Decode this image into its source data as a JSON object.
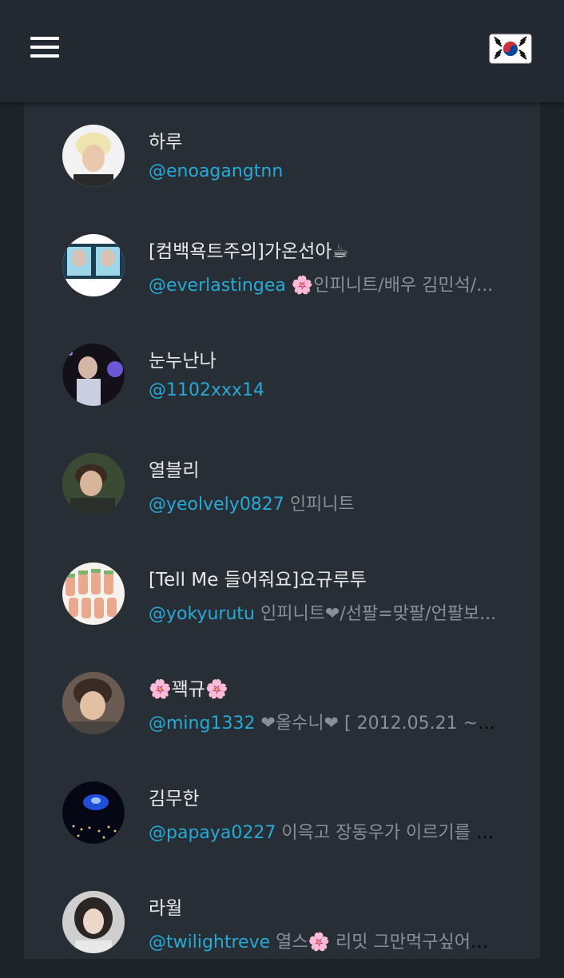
{
  "header": {
    "menu_icon": "hamburger-menu-icon",
    "language_flag": "south-korea-flag-icon"
  },
  "colors": {
    "background": "#1e232a",
    "topbar": "#232930",
    "panel": "#282e36",
    "handle": "#27a9d6",
    "name": "#e8e8e8",
    "bio": "#8a8f96"
  },
  "users": [
    {
      "name": "하루",
      "handle": "@enoagangtnn",
      "bio": ""
    },
    {
      "name": "[컴백욕트주의]가온선아☕",
      "handle": "@everlastingea",
      "bio": "🌸인피니트/배우 김민석/..."
    },
    {
      "name": "눈누난나",
      "handle": "@1102xxx14",
      "bio": ""
    },
    {
      "name": "열블리",
      "handle": "@yeolvely0827",
      "bio": "인피니트"
    },
    {
      "name": "[Tell Me 들어줘요]요규루투",
      "handle": "@yokyurutu",
      "bio": "인피니트❤/선팔=맞팔/언팔보..."
    },
    {
      "name": "🌸꽥규🌸",
      "handle": "@ming1332",
      "bio": "❤올수니❤ [ 2012.05.21 ~ i..."
    },
    {
      "name": "김무한",
      "handle": "@papaya0227",
      "bio": "이윽고 장동우가 이르기를 [..."
    },
    {
      "name": "라월",
      "handle": "@twilightreve",
      "bio": "열스🌸 리밋 그만먹구싶어요..."
    }
  ]
}
